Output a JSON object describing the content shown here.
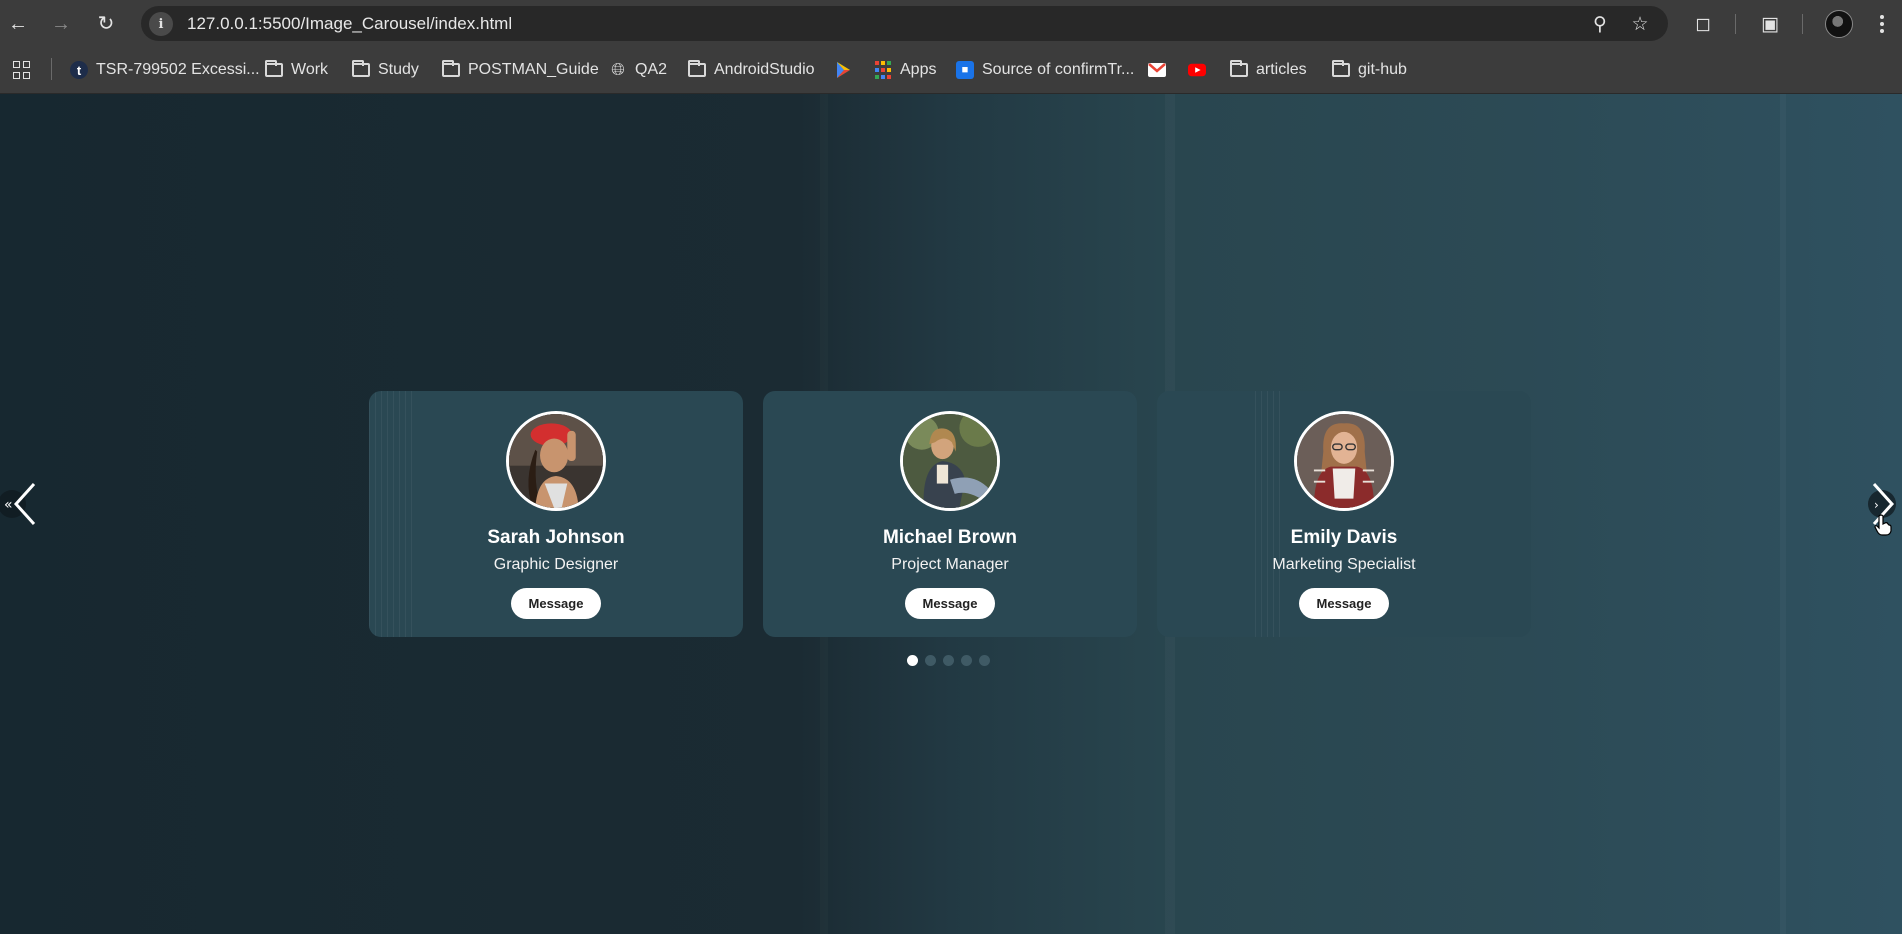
{
  "browser": {
    "url": "127.0.0.1:5500/Image_Carousel/index.html",
    "bookmarks": [
      {
        "label": "TSR-799502 Excessi...",
        "icon": "t-icon"
      },
      {
        "label": "Work",
        "icon": "folder-icon"
      },
      {
        "label": "Study",
        "icon": "folder-icon"
      },
      {
        "label": "POSTMAN_Guide",
        "icon": "folder-icon"
      },
      {
        "label": "QA2",
        "icon": "globe-icon"
      },
      {
        "label": "AndroidStudio",
        "icon": "folder-icon"
      },
      {
        "label": "",
        "icon": "play-store-icon"
      },
      {
        "label": "Apps",
        "icon": "apps-grid-icon"
      },
      {
        "label": "Source of confirmTr...",
        "icon": "bookmark-app-icon"
      },
      {
        "label": "",
        "icon": "gmail-icon"
      },
      {
        "label": "",
        "icon": "youtube-icon"
      },
      {
        "label": "articles",
        "icon": "folder-icon"
      },
      {
        "label": "git-hub",
        "icon": "folder-icon"
      }
    ]
  },
  "carousel": {
    "cards": [
      {
        "name": "Sarah Johnson",
        "role": "Graphic Designer",
        "button": "Message"
      },
      {
        "name": "Michael Brown",
        "role": "Project Manager",
        "button": "Message"
      },
      {
        "name": "Emily Davis",
        "role": "Marketing Specialist",
        "button": "Message"
      }
    ],
    "dot_count": 5,
    "active_dot": 1,
    "colors": {
      "card": "#2a4853",
      "dot_active": "#ffffff",
      "dot_inactive": "#3f5a65"
    }
  }
}
